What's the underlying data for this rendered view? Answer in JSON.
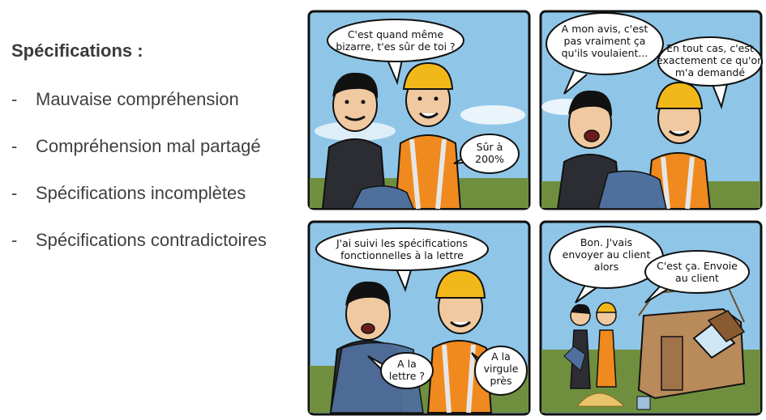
{
  "slide": {
    "heading": "Spécifications :",
    "bullet_marker": "-",
    "bullets": [
      "Mauvaise compréhension",
      "Compréhension mal partagé",
      "Spécifications incomplètes",
      "Spécifications contradictoires"
    ]
  },
  "comic": {
    "panel1": {
      "bubble_left": [
        "C'est quand même",
        "bizarre, t'es sûr de toi ?"
      ],
      "bubble_right": [
        "Sûr à",
        "200%"
      ]
    },
    "panel2": {
      "bubble_left": [
        "A mon avis, c'est",
        "pas vraiment ça",
        "qu'ils voulaient..."
      ],
      "bubble_right": [
        "En tout cas, c'est",
        "exactement ce qu'on",
        "m'a demandé"
      ]
    },
    "panel3": {
      "bubble_top": [
        "J'ai suivi les spécifications",
        "fonctionnelles à la lettre"
      ],
      "bubble_mid": [
        "A la",
        "lettre ?"
      ],
      "bubble_right": [
        "A la",
        "virgule",
        "près"
      ]
    },
    "panel4": {
      "bubble_left": [
        "Bon. J'vais",
        "envoyer au client",
        "alors"
      ],
      "bubble_right": [
        "C'est ça. Envoie",
        "au client"
      ]
    },
    "colors": {
      "sky": "#8fc6e8",
      "grass": "#6f8f3f",
      "vest": "#f08a1e",
      "helmet": "#f2b81a",
      "shirt": "#2b2d33",
      "skin": "#f0c9a0",
      "tarp": "#4f6f9c",
      "house": "#b98a5a"
    }
  }
}
